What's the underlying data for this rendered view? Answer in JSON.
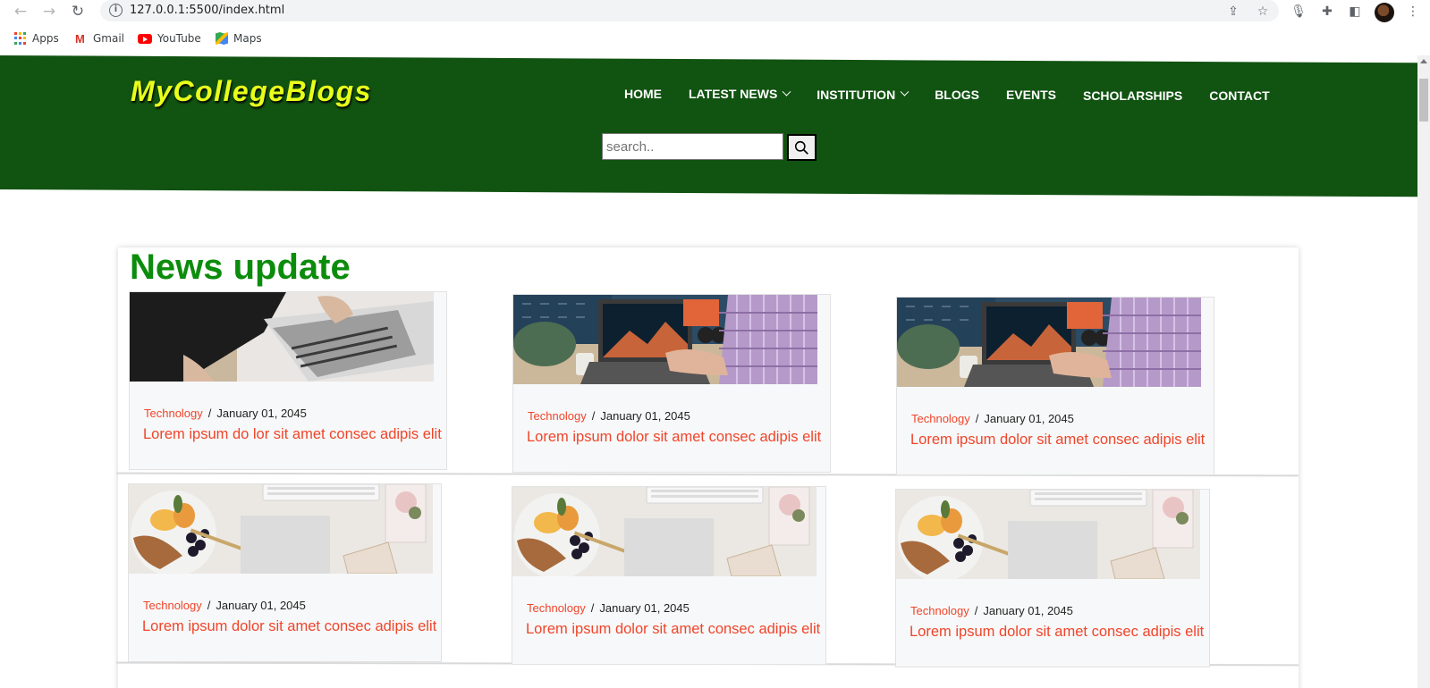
{
  "browser": {
    "url": "127.0.0.1:5500/index.html",
    "bookmarks": [
      {
        "label": "Apps"
      },
      {
        "label": "Gmail"
      },
      {
        "label": "YouTube"
      },
      {
        "label": "Maps"
      }
    ]
  },
  "site": {
    "logo": "MyCollegeBlogs",
    "nav": [
      {
        "label": "HOME",
        "dropdown": false
      },
      {
        "label": "LATEST NEWS",
        "dropdown": true
      },
      {
        "label": "INSTITUTION",
        "dropdown": true
      },
      {
        "label": "BLOGS",
        "dropdown": false
      },
      {
        "label": "EVENTS",
        "dropdown": false
      },
      {
        "label": "SCHOLARSHIPS",
        "dropdown": false
      },
      {
        "label": "CONTACT",
        "dropdown": false
      }
    ],
    "search": {
      "placeholder": "search.."
    },
    "colors": {
      "header": "#115311",
      "logo": "#e9ff1b",
      "accent": "#f0452a",
      "title": "#0c8c0c"
    }
  },
  "news": {
    "title": "News update",
    "cards": [
      {
        "category": "Technology",
        "date": "January 01, 2045",
        "headline": "Lorem ipsum do lor sit amet consec adipis elit",
        "image": "laptop-typing"
      },
      {
        "category": "Technology",
        "date": "January 01, 2045",
        "headline": "Lorem ipsum dolor sit amet consec adipis elit",
        "image": "desk-laptop"
      },
      {
        "category": "Technology",
        "date": "January 01, 2045",
        "headline": "Lorem ipsum dolor sit amet consec adipis elit",
        "image": "desk-laptop"
      },
      {
        "category": "Technology",
        "date": "January 01, 2045",
        "headline": "Lorem ipsum dolor sit amet consec adipis elit",
        "image": "breakfast-desk"
      },
      {
        "category": "Technology",
        "date": "January 01, 2045",
        "headline": "Lorem ipsum dolor sit amet consec adipis elit",
        "image": "breakfast-desk"
      },
      {
        "category": "Technology",
        "date": "January 01, 2045",
        "headline": "Lorem ipsum dolor sit amet consec adipis elit",
        "image": "breakfast-desk"
      }
    ]
  }
}
